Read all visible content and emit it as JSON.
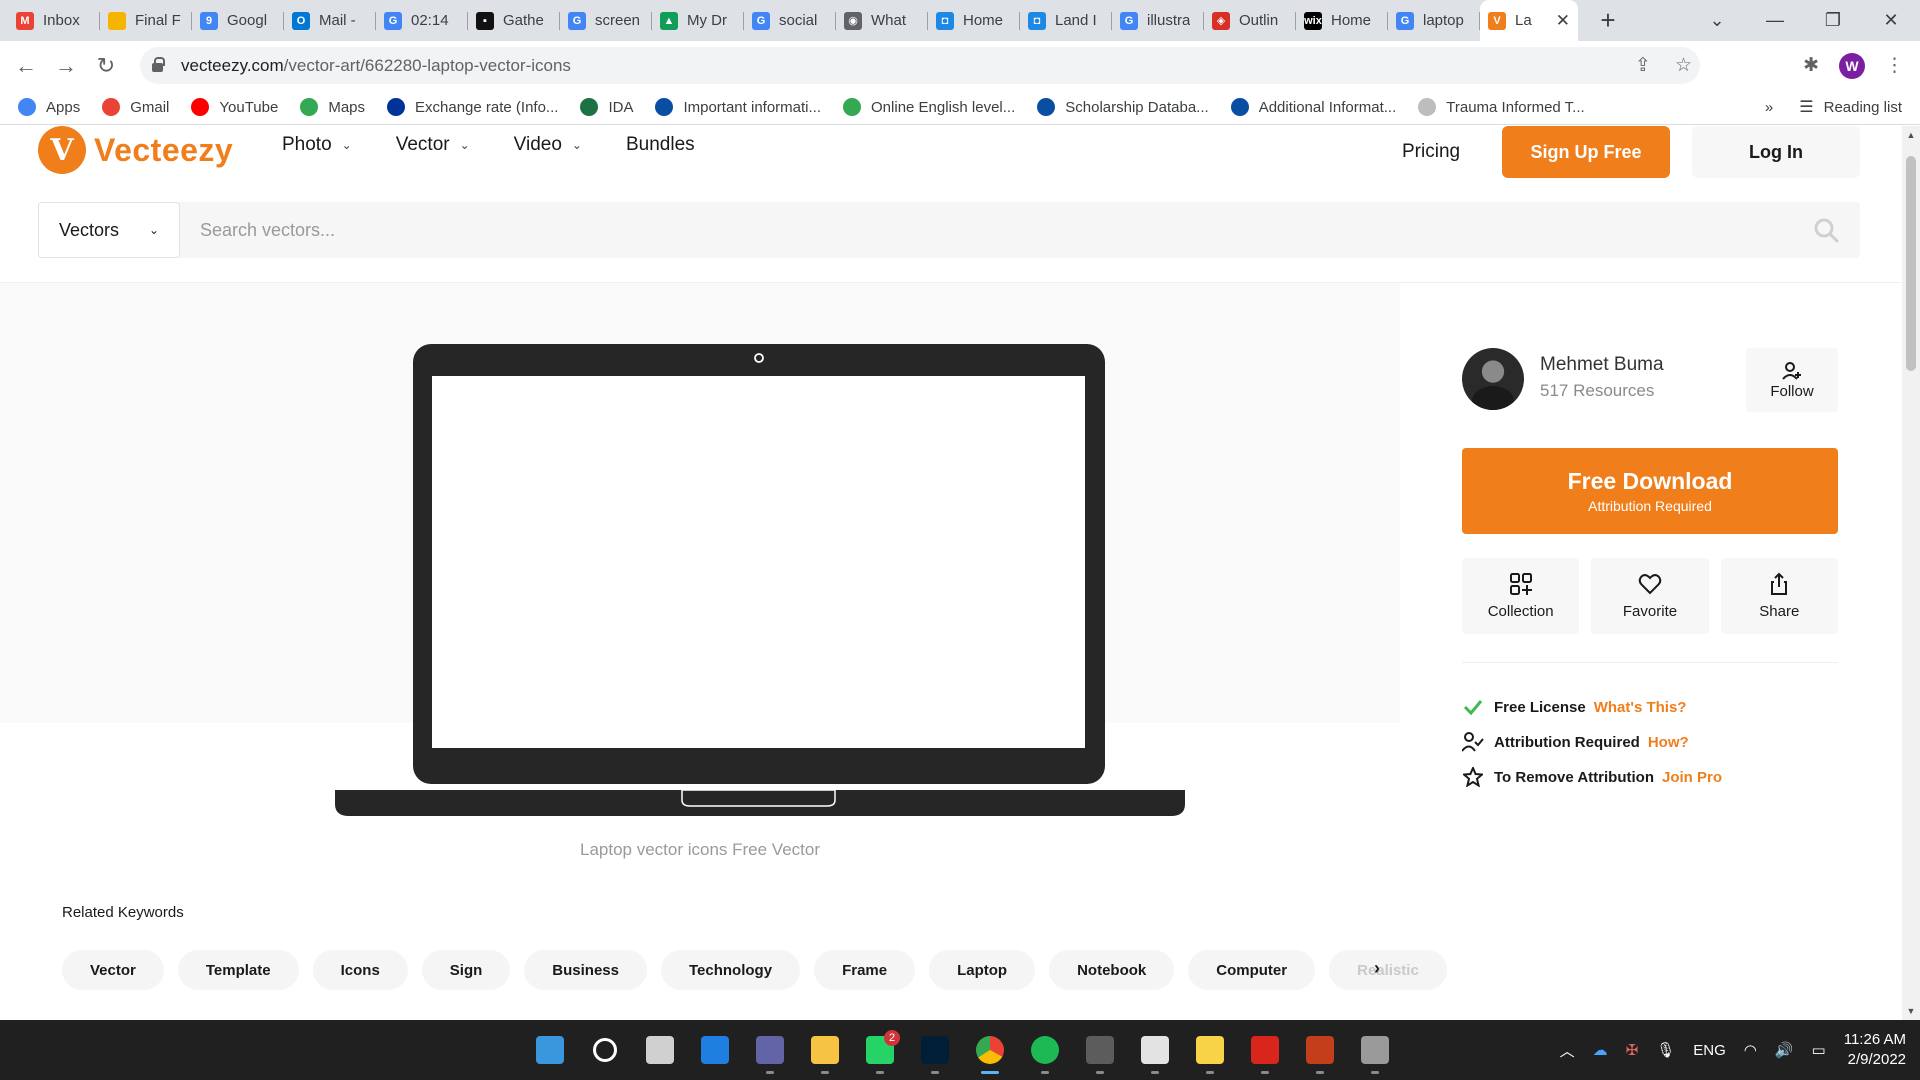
{
  "browser": {
    "tabs": [
      {
        "label": "Inbox",
        "icon": "gmail-icon",
        "color": "#ea4335",
        "glyph": "M"
      },
      {
        "label": "Final F",
        "icon": "slides-icon",
        "color": "#f4b400",
        "glyph": ""
      },
      {
        "label": "Googl",
        "icon": "calendar-icon",
        "color": "#4285f4",
        "glyph": "9"
      },
      {
        "label": "Mail -",
        "icon": "outlook-icon",
        "color": "#0078d4",
        "glyph": "O"
      },
      {
        "label": "02:14",
        "icon": "google-icon",
        "color": "#4285f4",
        "glyph": "G"
      },
      {
        "label": "Gathe",
        "icon": "gather-icon",
        "color": "#111111",
        "glyph": "▪"
      },
      {
        "label": "screen",
        "icon": "google-icon",
        "color": "#4285f4",
        "glyph": "G"
      },
      {
        "label": "My Dr",
        "icon": "drive-icon",
        "color": "#0f9d58",
        "glyph": "▲"
      },
      {
        "label": "social",
        "icon": "google-icon",
        "color": "#4285f4",
        "glyph": "G"
      },
      {
        "label": "What",
        "icon": "globe-icon",
        "color": "#5f6368",
        "glyph": "◉"
      },
      {
        "label": "Home",
        "icon": "chat-icon",
        "color": "#1e88e5",
        "glyph": "◘"
      },
      {
        "label": "Land I",
        "icon": "chat-icon",
        "color": "#1e88e5",
        "glyph": "◘"
      },
      {
        "label": "illustra",
        "icon": "google-icon",
        "color": "#4285f4",
        "glyph": "G"
      },
      {
        "label": "Outlin",
        "icon": "pdf-icon",
        "color": "#d93025",
        "glyph": "◈"
      },
      {
        "label": "Home",
        "icon": "wix-icon",
        "color": "#000000",
        "glyph": "wix"
      },
      {
        "label": "laptop",
        "icon": "google-icon",
        "color": "#4285f4",
        "glyph": "G"
      },
      {
        "label": "La",
        "icon": "vecteezy-icon",
        "color": "#f07e1b",
        "glyph": "V",
        "active": true
      }
    ],
    "url_domain": "vecteezy.com",
    "url_path": "/vector-art/662280-laptop-vector-icons",
    "profile_initial": "W",
    "bookmarks": [
      {
        "label": "Apps",
        "icon": "apps-grid-icon",
        "color": "#4285f4"
      },
      {
        "label": "Gmail",
        "icon": "gmail-icon",
        "color": "#ea4335"
      },
      {
        "label": "YouTube",
        "icon": "youtube-icon",
        "color": "#ff0000"
      },
      {
        "label": "Maps",
        "icon": "maps-pin-icon",
        "color": "#34a853"
      },
      {
        "label": "Exchange rate (Info...",
        "icon": "eu-flag-icon",
        "color": "#003399"
      },
      {
        "label": "IDA",
        "icon": "ida-icon",
        "color": "#1e7145"
      },
      {
        "label": "Important informati...",
        "icon": "d-icon",
        "color": "#0a4ea3"
      },
      {
        "label": "Online English level...",
        "icon": "dots-icon",
        "color": "#34a853"
      },
      {
        "label": "Scholarship Databa...",
        "icon": "d-icon",
        "color": "#0a4ea3"
      },
      {
        "label": "Additional Informat...",
        "icon": "d-icon",
        "color": "#0a4ea3"
      },
      {
        "label": "Trauma Informed T...",
        "icon": "globe-icon",
        "color": "#bdbdbd"
      }
    ],
    "reading_list": "Reading list"
  },
  "site": {
    "brand": "Vecteezy",
    "brand_color": "#f07e1b",
    "nav": [
      "Photo",
      "Vector",
      "Video",
      "Bundles"
    ],
    "pricing": "Pricing",
    "signup": "Sign Up Free",
    "login": "Log In",
    "search": {
      "type": "Vectors",
      "placeholder": "Search vectors..."
    }
  },
  "asset": {
    "caption": "Laptop vector icons Free Vector",
    "related_title": "Related Keywords",
    "keywords": [
      "Vector",
      "Template",
      "Icons",
      "Sign",
      "Business",
      "Technology",
      "Frame",
      "Laptop",
      "Notebook",
      "Computer",
      "Realistic"
    ]
  },
  "sidebar": {
    "author_name": "Mehmet Buma",
    "author_resources": "517 Resources",
    "follow": "Follow",
    "download_title": "Free Download",
    "download_sub": "Attribution Required",
    "actions": [
      "Collection",
      "Favorite",
      "Share"
    ],
    "license": [
      {
        "text": "Free License",
        "link": "What's This?",
        "icon": "check-icon"
      },
      {
        "text": "Attribution Required",
        "link": "How?",
        "icon": "user-check-icon"
      },
      {
        "text": "To Remove Attribution",
        "link": "Join Pro",
        "icon": "star-icon"
      }
    ]
  },
  "taskbar": {
    "apps": [
      {
        "icon": "windows-start-icon",
        "color": "#3a96dd"
      },
      {
        "icon": "search-icon",
        "color": "#ffffff"
      },
      {
        "icon": "task-view-icon",
        "color": "#d0d0d0"
      },
      {
        "icon": "widgets-icon",
        "color": "#1f7fe0"
      },
      {
        "icon": "teams-chat-icon",
        "color": "#6264a7"
      },
      {
        "icon": "file-explorer-icon",
        "color": "#f6c342"
      },
      {
        "icon": "whatsapp-icon",
        "color": "#25d366",
        "badge": "2"
      },
      {
        "icon": "photoshop-icon",
        "color": "#001e36"
      },
      {
        "icon": "chrome-icon",
        "color": "#4285f4",
        "active": true
      },
      {
        "icon": "spotify-icon",
        "color": "#1db954"
      },
      {
        "icon": "calculator-icon",
        "color": "#5c5c5c"
      },
      {
        "icon": "snipping-tool-icon",
        "color": "#e3e3e3"
      },
      {
        "icon": "sticky-notes-icon",
        "color": "#f8d247"
      },
      {
        "icon": "acrobat-icon",
        "color": "#d8261c"
      },
      {
        "icon": "powerpoint-icon",
        "color": "#c43e1c"
      },
      {
        "icon": "settings-gear-icon",
        "color": "#9a9a9a"
      }
    ],
    "language": "ENG",
    "time": "11:26 AM",
    "date": "2/9/2022"
  }
}
